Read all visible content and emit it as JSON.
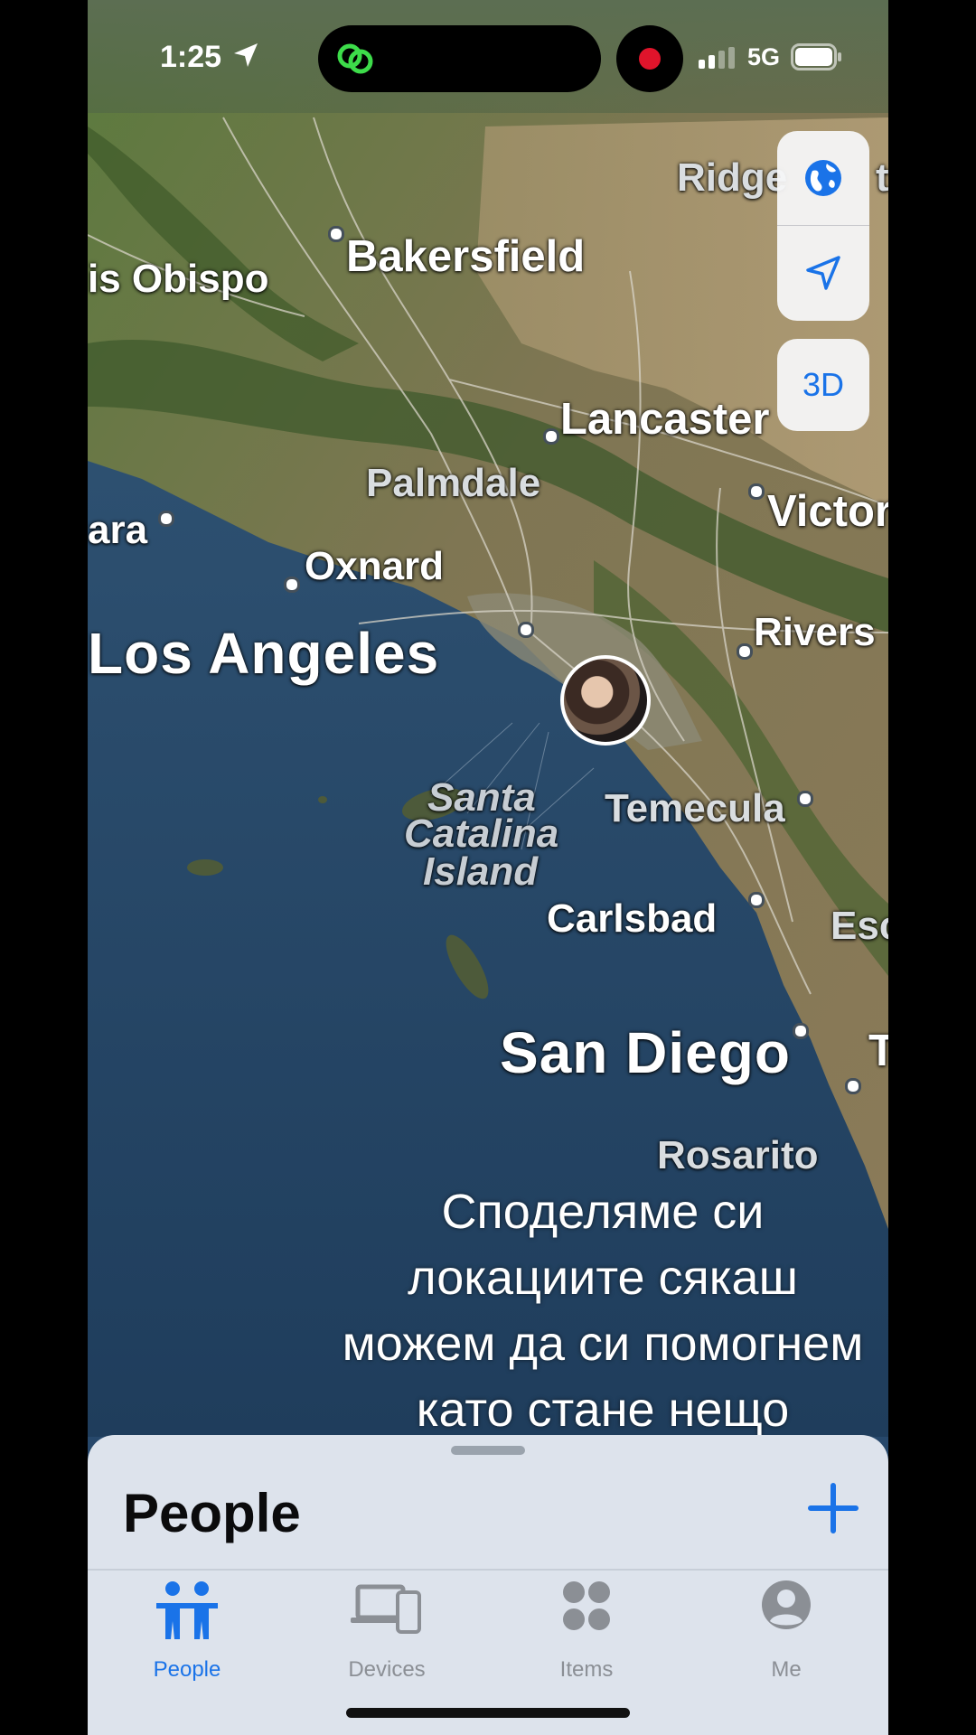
{
  "status_bar": {
    "time": "1:25",
    "network": "5G"
  },
  "map": {
    "labels": {
      "bakersfield": "Bakersfield",
      "san_luis_obispo": "is Obispo",
      "ridgecrest": "Ridge",
      "ridgecrest_tail": "t",
      "lancaster": "Lancaster",
      "palmdale": "Palmdale",
      "victorville": "Victor",
      "santa_barbara": "ara",
      "oxnard": "Oxnard",
      "los_angeles": "Los Angeles",
      "riverside": "Rivers",
      "santa_catalina_1": "Santa",
      "santa_catalina_2": "Catalina",
      "santa_catalina_3": "Island",
      "temecula": "Temecula",
      "carlsbad": "Carlsbad",
      "escondido": "Esc",
      "san_diego": "San Diego",
      "tijuana": "T",
      "rosarito": "Rosarito"
    },
    "controls": {
      "map_style_icon": "globe-icon",
      "location_icon": "location-arrow-icon",
      "three_d_label": "3D"
    }
  },
  "caption": {
    "line1": "Споделяме си",
    "line2": "локациите сякаш",
    "line3": "можем да си помогнем",
    "line4": "като стане нещо"
  },
  "sheet": {
    "title": "People",
    "add_icon": "plus-icon"
  },
  "tabs": [
    {
      "label": "People",
      "icon": "people-icon",
      "active": true
    },
    {
      "label": "Devices",
      "icon": "devices-icon",
      "active": false
    },
    {
      "label": "Items",
      "icon": "items-icon",
      "active": false
    },
    {
      "label": "Me",
      "icon": "person-circle-icon",
      "active": false
    }
  ],
  "colors": {
    "accent": "#1a73e8",
    "sheet_background": "#dde3ec",
    "ocean": "#2a4d70",
    "land": "#6b7a4a"
  }
}
